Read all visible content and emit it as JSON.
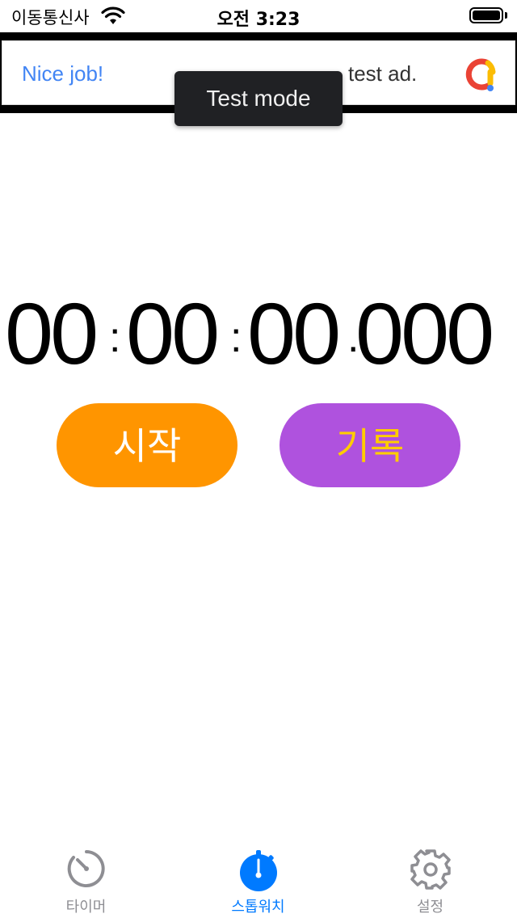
{
  "status_bar": {
    "carrier": "이동통신사",
    "time": "오전 3:23"
  },
  "ad": {
    "lead_text": "Nice job!",
    "trail_text": "test ad.",
    "toast": "Test mode"
  },
  "stopwatch": {
    "hours": "00",
    "minutes": "00",
    "seconds": "00",
    "millis": "000",
    "start_label": "시작",
    "lap_label": "기록"
  },
  "colors": {
    "start_button": "#ff9500",
    "lap_button": "#af52de",
    "lap_text": "#ffcc00",
    "active_tab": "#007aff",
    "inactive_tab": "#8e8e93"
  },
  "tabs": [
    {
      "label": "타이머",
      "icon": "timer-icon",
      "active": false
    },
    {
      "label": "스톱워치",
      "icon": "stopwatch-icon",
      "active": true
    },
    {
      "label": "설정",
      "icon": "gear-icon",
      "active": false
    }
  ]
}
